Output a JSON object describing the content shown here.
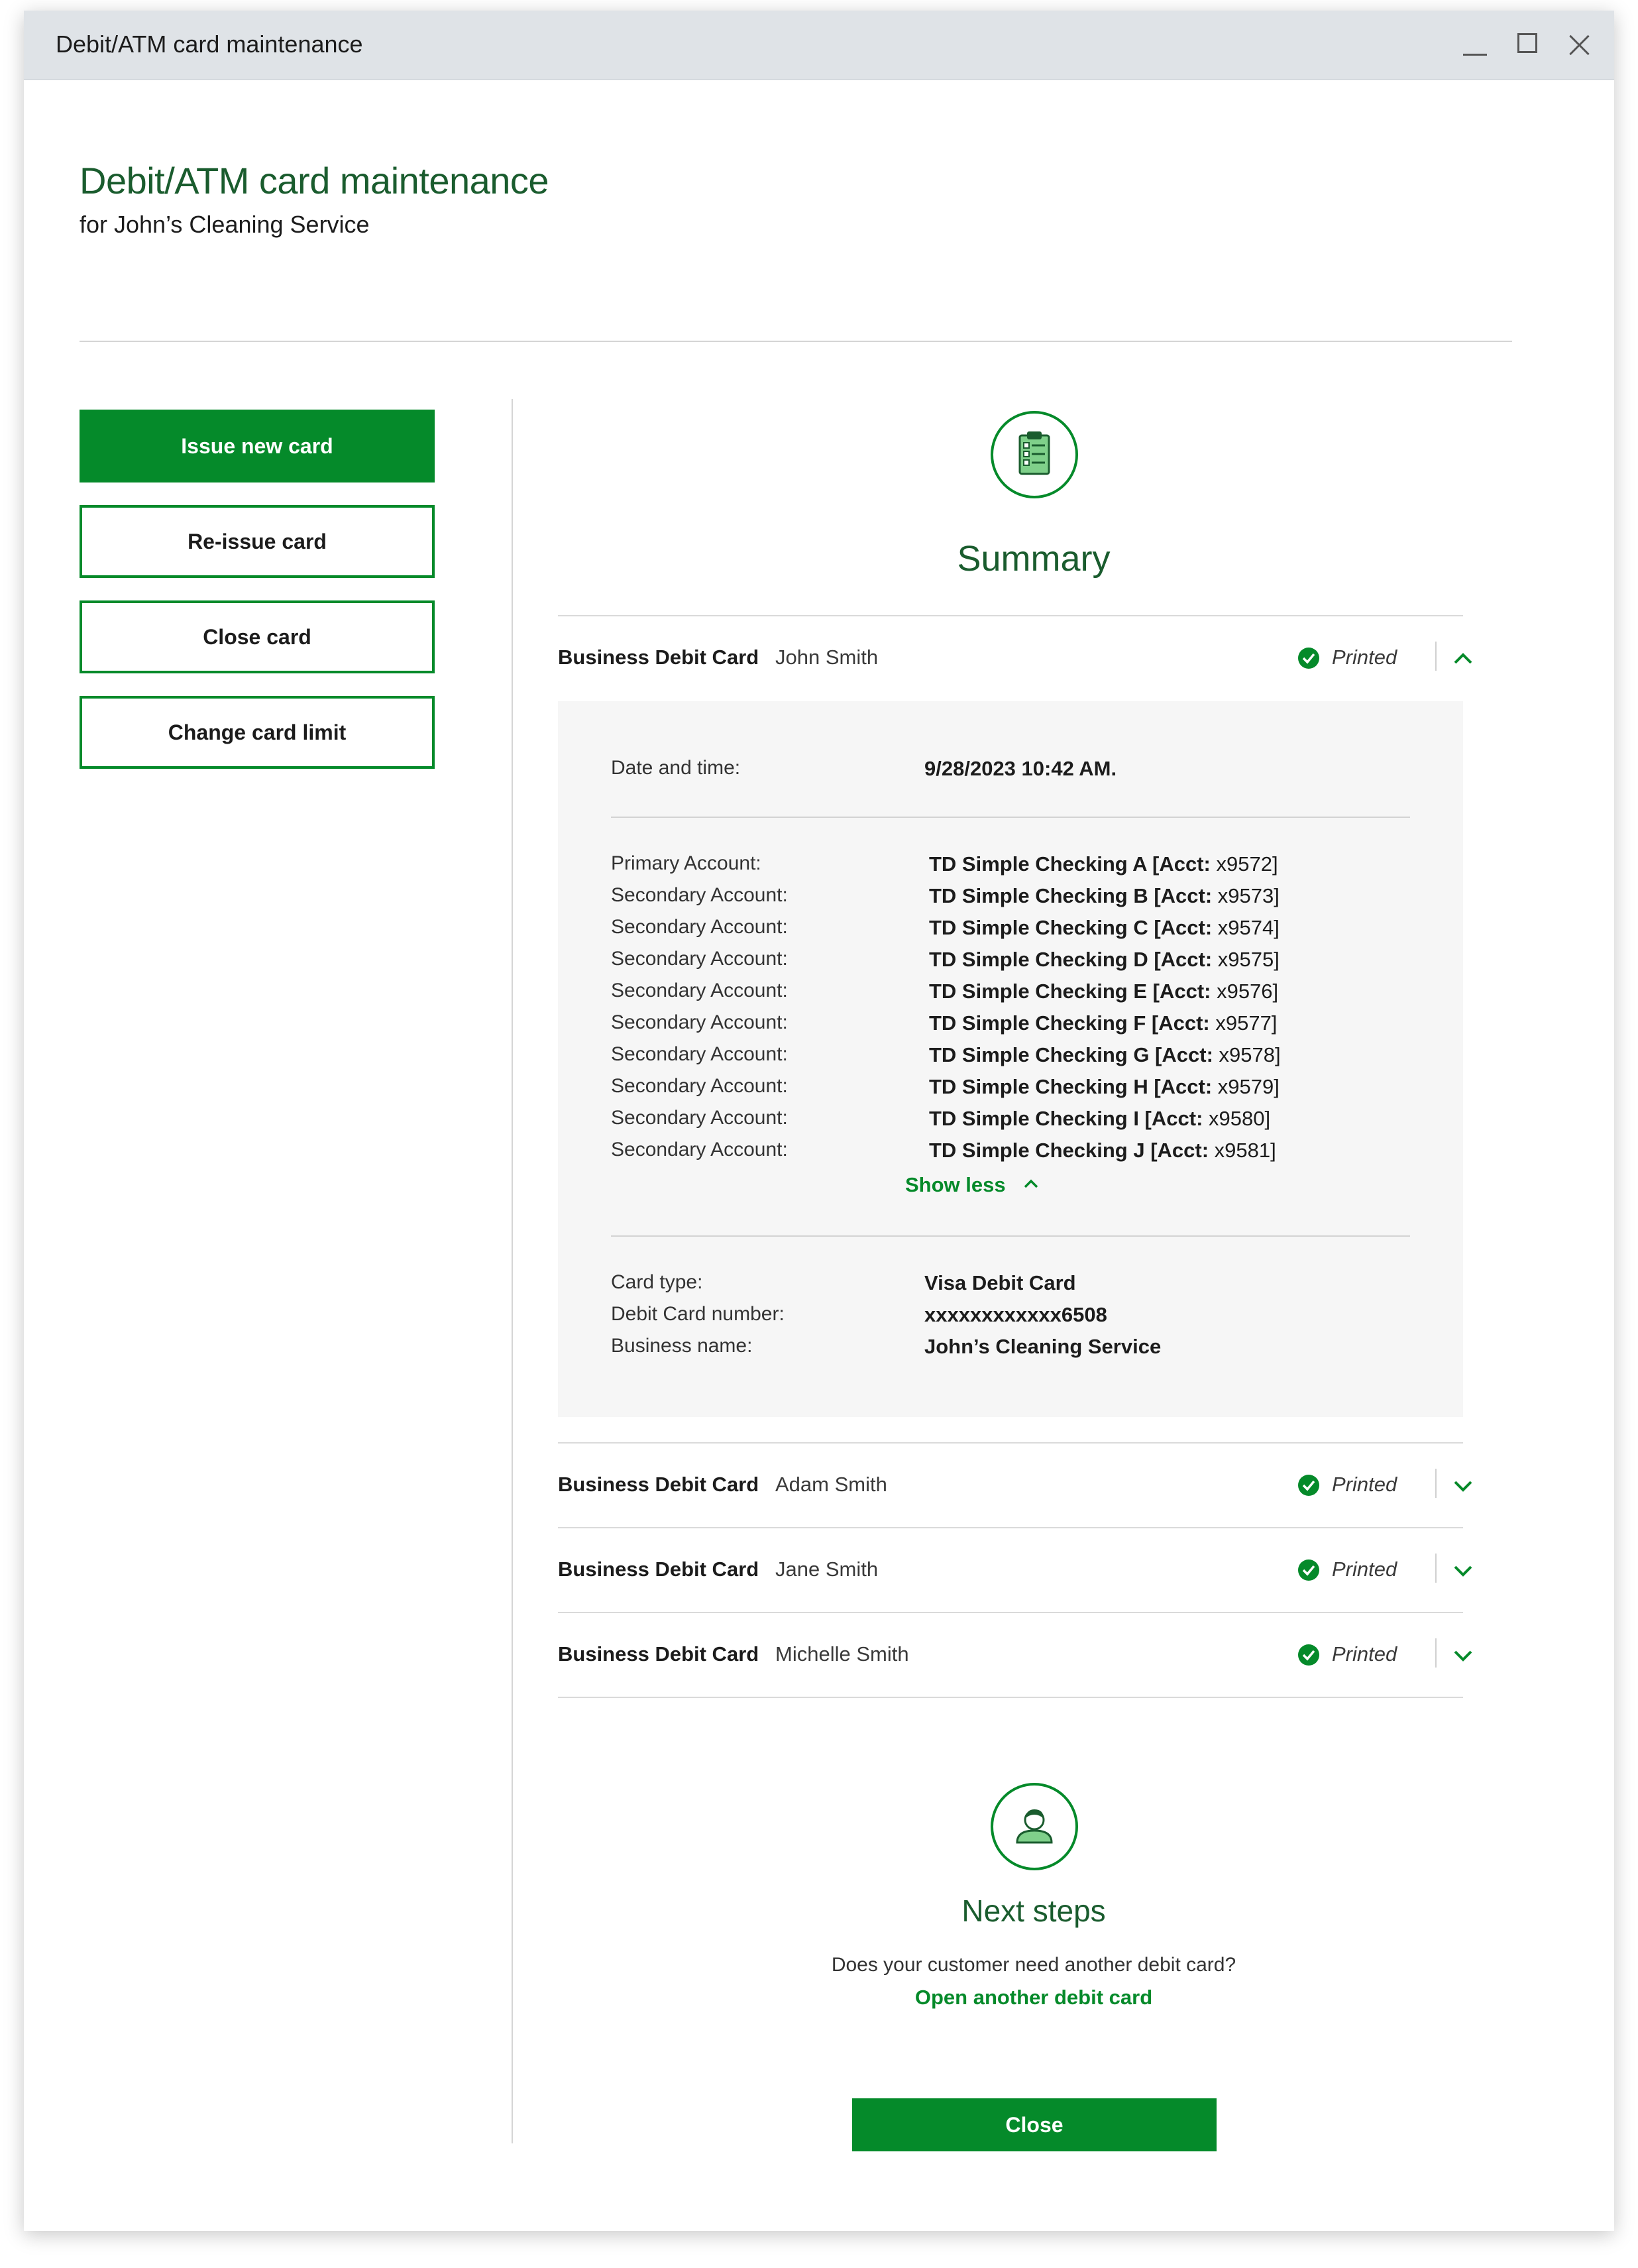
{
  "window": {
    "title": "Debit/ATM card maintenance"
  },
  "header": {
    "title": "Debit/ATM card maintenance",
    "subtitle": "for John’s Cleaning Service"
  },
  "sidebar": {
    "buttons": [
      {
        "label": "Issue new card"
      },
      {
        "label": "Re-issue card"
      },
      {
        "label": "Close card"
      },
      {
        "label": "Change card limit"
      }
    ]
  },
  "summary": {
    "title": "Summary",
    "icon": "clipboard-checklist-icon",
    "cards": [
      {
        "type": "Business Debit Card",
        "holder": "John Smith",
        "status": "Printed",
        "expanded": true
      },
      {
        "type": "Business Debit Card",
        "holder": "Adam Smith",
        "status": "Printed",
        "expanded": false
      },
      {
        "type": "Business Debit Card",
        "holder": "Jane Smith",
        "status": "Printed",
        "expanded": false
      },
      {
        "type": "Business Debit Card",
        "holder": "Michelle Smith",
        "status": "Printed",
        "expanded": false
      }
    ],
    "details": {
      "datetime_label": "Date and time:",
      "datetime_value": "9/28/2023 10:42 AM.",
      "accounts": [
        {
          "label": "Primary Account:",
          "name": "TD Simple Checking A [Acct: ",
          "num": "x9572]"
        },
        {
          "label": "Secondary Account:",
          "name": "TD Simple Checking B [Acct: ",
          "num": "x9573]"
        },
        {
          "label": "Secondary Account:",
          "name": "TD Simple Checking C [Acct: ",
          "num": "x9574]"
        },
        {
          "label": "Secondary Account:",
          "name": "TD Simple Checking D [Acct: ",
          "num": "x9575]"
        },
        {
          "label": "Secondary Account:",
          "name": "TD Simple Checking E [Acct: ",
          "num": "x9576]"
        },
        {
          "label": "Secondary Account:",
          "name": "TD Simple Checking F [Acct: ",
          "num": "x9577]"
        },
        {
          "label": "Secondary Account:",
          "name": "TD Simple Checking G [Acct: ",
          "num": "x9578]"
        },
        {
          "label": "Secondary Account:",
          "name": "TD Simple Checking H [Acct: ",
          "num": "x9579]"
        },
        {
          "label": "Secondary Account:",
          "name": "TD Simple Checking I [Acct: ",
          "num": "x9580]"
        },
        {
          "label": "Secondary Account:",
          "name": "TD Simple Checking J [Acct: ",
          "num": "x9581]"
        }
      ],
      "show_less_label": "Show less",
      "card_type_label": "Card type:",
      "card_type_value": "Visa Debit Card",
      "card_number_label": "Debit Card number:",
      "card_number_value": "xxxxxxxxxxxx6508",
      "business_name_label": "Business name:",
      "business_name_value": "John’s Cleaning Service"
    }
  },
  "next_steps": {
    "icon": "customer-avatar-icon",
    "title": "Next steps",
    "question": "Does your customer need another debit card?",
    "link": "Open another debit card"
  },
  "footer": {
    "close_label": "Close"
  },
  "colors": {
    "brand_green": "#058a2a",
    "heading_green": "#1a5c2e",
    "panel_bg": "#f6f6f6"
  }
}
